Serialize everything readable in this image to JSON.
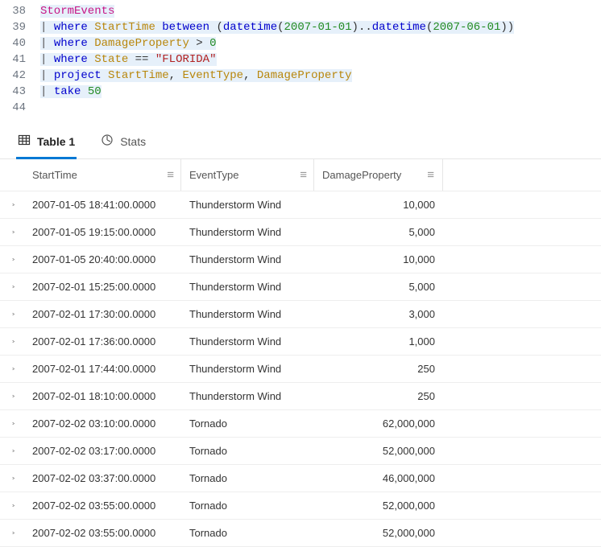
{
  "editor": {
    "lines": [
      {
        "num": 38
      },
      {
        "num": 39
      },
      {
        "num": 40
      },
      {
        "num": 41
      },
      {
        "num": 42
      },
      {
        "num": 43
      },
      {
        "num": 44
      }
    ],
    "tokens": {
      "tableName": "StormEvents",
      "pipe": "|",
      "where": "where",
      "between": "between",
      "datetime": "datetime",
      "project": "project",
      "take": "take",
      "startTime": "StartTime",
      "eventType": "EventType",
      "damageProperty": "DamageProperty",
      "state": "State",
      "eq": "==",
      "gt": ">",
      "zero": "0",
      "fifty": "50",
      "date1": "2007-01-01",
      "date2": "2007-06-01",
      "florida": "\"FLORIDA\"",
      "dotdot": "..",
      "comma": ","
    }
  },
  "tabs": {
    "table": "Table 1",
    "stats": "Stats"
  },
  "columns": {
    "c1": "StartTime",
    "c2": "EventType",
    "c3": "DamageProperty"
  },
  "rows": [
    {
      "t": "2007-01-05 18:41:00.0000",
      "e": "Thunderstorm Wind",
      "d": "10,000"
    },
    {
      "t": "2007-01-05 19:15:00.0000",
      "e": "Thunderstorm Wind",
      "d": "5,000"
    },
    {
      "t": "2007-01-05 20:40:00.0000",
      "e": "Thunderstorm Wind",
      "d": "10,000"
    },
    {
      "t": "2007-02-01 15:25:00.0000",
      "e": "Thunderstorm Wind",
      "d": "5,000"
    },
    {
      "t": "2007-02-01 17:30:00.0000",
      "e": "Thunderstorm Wind",
      "d": "3,000"
    },
    {
      "t": "2007-02-01 17:36:00.0000",
      "e": "Thunderstorm Wind",
      "d": "1,000"
    },
    {
      "t": "2007-02-01 17:44:00.0000",
      "e": "Thunderstorm Wind",
      "d": "250"
    },
    {
      "t": "2007-02-01 18:10:00.0000",
      "e": "Thunderstorm Wind",
      "d": "250"
    },
    {
      "t": "2007-02-02 03:10:00.0000",
      "e": "Tornado",
      "d": "62,000,000"
    },
    {
      "t": "2007-02-02 03:17:00.0000",
      "e": "Tornado",
      "d": "52,000,000"
    },
    {
      "t": "2007-02-02 03:37:00.0000",
      "e": "Tornado",
      "d": "46,000,000"
    },
    {
      "t": "2007-02-02 03:55:00.0000",
      "e": "Tornado",
      "d": "52,000,000"
    },
    {
      "t": "2007-02-02 03:55:00.0000",
      "e": "Tornado",
      "d": "52,000,000"
    }
  ]
}
